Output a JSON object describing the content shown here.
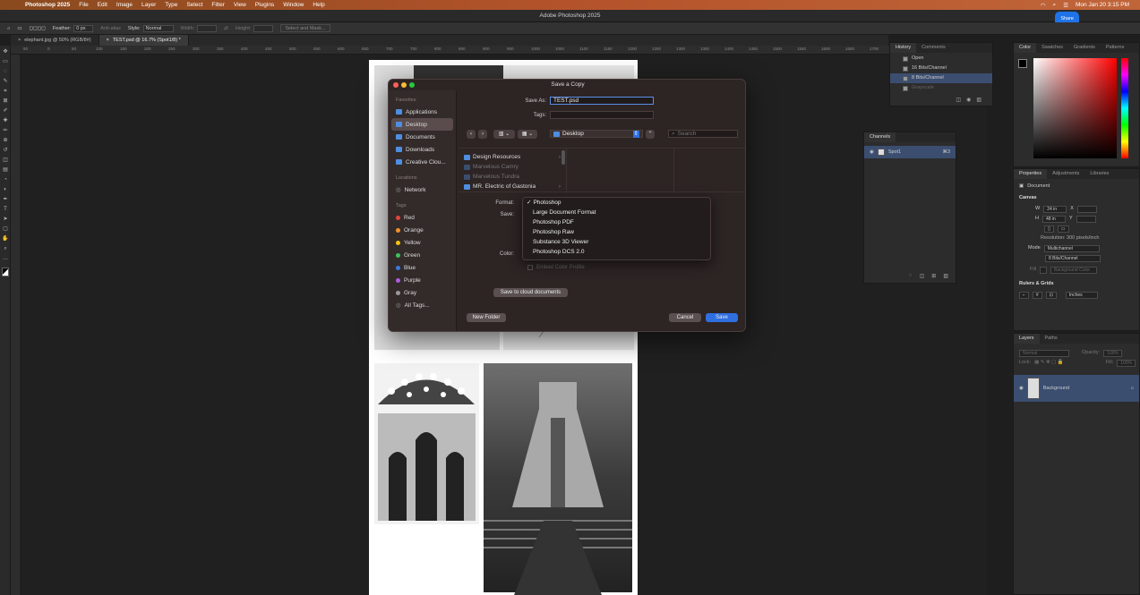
{
  "menubar": {
    "app": "Photoshop 2025",
    "items": [
      "File",
      "Edit",
      "Image",
      "Layer",
      "Type",
      "Select",
      "Filter",
      "View",
      "Plugins",
      "Window",
      "Help"
    ],
    "clock": "Mon Jan 20  3:15 PM"
  },
  "window": {
    "title": "Adobe Photoshop 2025",
    "share": "Share"
  },
  "options": {
    "feather_label": "Feather:",
    "feather_value": "0 px",
    "antialias": "Anti-alias",
    "style_label": "Style:",
    "style_value": "Normal",
    "width_label": "Width:",
    "height_label": "Height:",
    "select_mask": "Select and Mask..."
  },
  "tabs": [
    {
      "label": "elephant.jpg @ 50% (RGB/8#)"
    },
    {
      "label": "TEST.psd @ 16.7% (Spot1/8) *"
    }
  ],
  "ruler_ticks": [
    "50",
    "0",
    "50",
    "100",
    "150",
    "200",
    "250",
    "300",
    "350",
    "400",
    "450",
    "500",
    "550",
    "600",
    "650",
    "700",
    "750",
    "800",
    "850",
    "900",
    "950",
    "1000",
    "1050",
    "1100",
    "1150",
    "1200",
    "1250",
    "1300",
    "1350",
    "1400",
    "1450",
    "1500",
    "1550",
    "1600",
    "1650",
    "1700",
    "1750",
    "1800",
    "1850"
  ],
  "dialog": {
    "title": "Save a Copy",
    "save_as_label": "Save As:",
    "save_as_value": "TEST.psd",
    "tags_label": "Tags:",
    "location": "Desktop",
    "search_placeholder": "Search",
    "sidebar": {
      "favorites_header": "Favorites",
      "favorites": [
        "Applications",
        "Desktop",
        "Documents",
        "Downloads",
        "Creative Clou..."
      ],
      "locations_header": "Locations",
      "locations": [
        "Network"
      ],
      "tags_header": "Tags",
      "tags": [
        {
          "name": "Red",
          "color": "#e2453c"
        },
        {
          "name": "Orange",
          "color": "#f0932b"
        },
        {
          "name": "Yellow",
          "color": "#f1c40f"
        },
        {
          "name": "Green",
          "color": "#3cc35a"
        },
        {
          "name": "Blue",
          "color": "#3b7be0"
        },
        {
          "name": "Purple",
          "color": "#b35be0"
        },
        {
          "name": "Gray",
          "color": "#9a9a9a"
        },
        {
          "name": "All Tags...",
          "color": ""
        }
      ]
    },
    "files": [
      "Design Resources",
      "Marvelous Camry",
      "Marvelous Tundra",
      "MR. Electric of Gastonia"
    ],
    "format_label": "Format:",
    "save_label": "Save:",
    "color_label": "Color:",
    "formats": [
      "Photoshop",
      "Large Document Format",
      "Photoshop PDF",
      "Photoshop Raw",
      "Substance 3D Viewer",
      "Photoshop DCS 2.0"
    ],
    "embed_profile": "Embed Color Profile",
    "cloud_button": "Save to cloud documents",
    "new_folder": "New Folder",
    "cancel": "Cancel",
    "save": "Save"
  },
  "history": {
    "tabs": [
      "History",
      "Comments"
    ],
    "items": [
      "Open",
      "16 Bits/Channel",
      "8 Bits/Channel",
      "Grayscale"
    ]
  },
  "channels": {
    "title": "Channels",
    "item": "Spot1",
    "shortcut": "⌘3"
  },
  "color_panel": {
    "tabs": [
      "Color",
      "Swatches",
      "Gradients",
      "Patterns"
    ]
  },
  "properties": {
    "tabs": [
      "Properties",
      "Adjustments",
      "Libraries"
    ],
    "doc_label": "Document",
    "canvas_header": "Canvas",
    "w_label": "W",
    "w_value": "24 in",
    "h_label": "H",
    "h_value": "48 in",
    "x_label": "X",
    "y_label": "Y",
    "resolution": "Resolution: 300 pixels/inch",
    "mode_label": "Mode",
    "mode_value": "Multichannel",
    "depth_value": "8 Bits/Channel",
    "fill_label": "Fill",
    "fill_value": "Background Color",
    "rulers_header": "Rulers & Grids",
    "units_value": "Inches"
  },
  "layers": {
    "tabs": [
      "Layers",
      "Paths"
    ],
    "blend": "Normal",
    "opacity_label": "Opacity:",
    "opacity_value": "100%",
    "lock_label": "Lock:",
    "fill_label": "Fill:",
    "fill_value": "100%",
    "layer_name": "Background"
  }
}
